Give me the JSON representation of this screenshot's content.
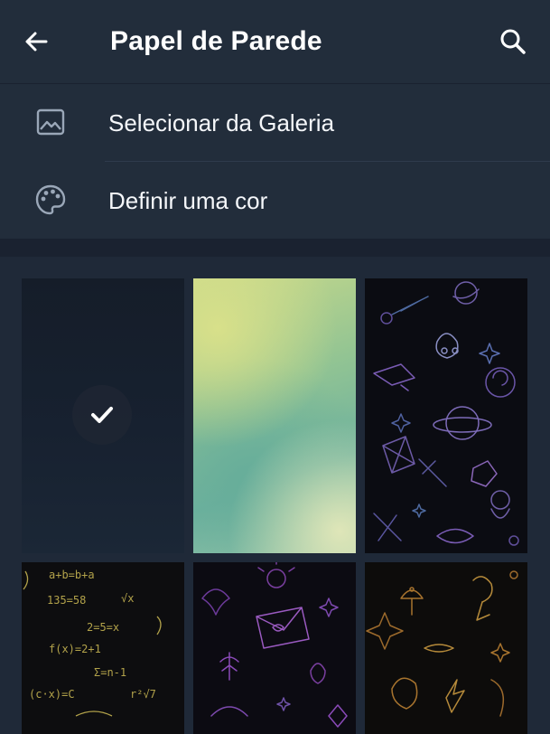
{
  "header": {
    "title": "Papel de Parede",
    "back_icon": "arrow-left-icon",
    "search_icon": "search-icon"
  },
  "menu": {
    "items": [
      {
        "label": "Selecionar da Galeria",
        "icon": "image-icon"
      },
      {
        "label": "Definir uma cor",
        "icon": "palette-icon"
      }
    ]
  },
  "wallpapers": {
    "selected_index": 0,
    "items": [
      {
        "name": "dark-gradient",
        "selected": true
      },
      {
        "name": "green-yellow-gradient",
        "selected": false
      },
      {
        "name": "space-doodles",
        "selected": false
      },
      {
        "name": "math-doodles",
        "selected": false
      },
      {
        "name": "purple-doodles",
        "selected": false
      },
      {
        "name": "gold-doodles",
        "selected": false
      }
    ],
    "math_text": [
      "a+b=b+a",
      "135=58",
      "√x",
      "2=5=x",
      "f(x)=2+1",
      "Σ=n-1",
      "(c·x)=C",
      "r²√7"
    ]
  },
  "colors": {
    "header_bg": "#222d3b",
    "page_bg": "#1c2532",
    "accent_text": "#ffffff"
  }
}
